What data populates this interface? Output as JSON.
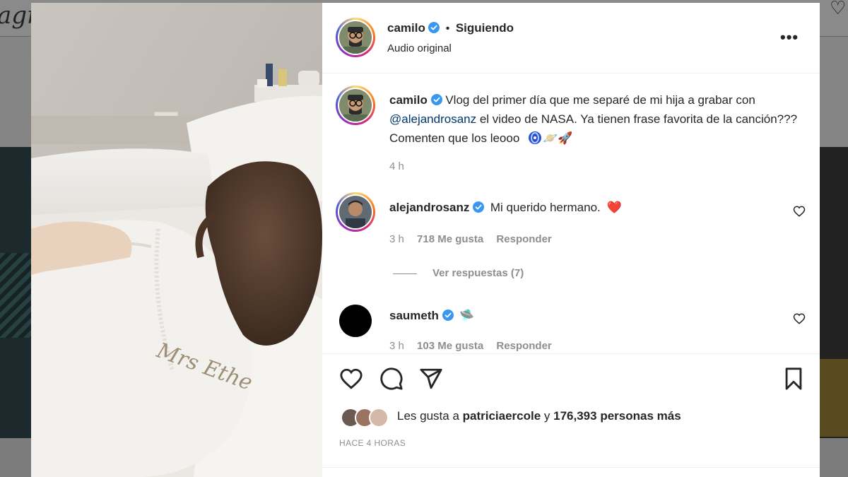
{
  "background": {
    "logo_text": "agr"
  },
  "post": {
    "author": "camilo",
    "follow_status": "Siguiendo",
    "subtitle": "Audio original",
    "more_label": "•••"
  },
  "caption": {
    "username": "camilo",
    "text_before": "Vlog del primer día que me separé de mi hija a grabar con ",
    "mention": "@alejandrosanz",
    "text_after": " el video de NASA. Ya tienen frase favorita de la canción??? Comenten que los leooo",
    "emojis": "🪐🚀",
    "time": "4 h"
  },
  "comments": [
    {
      "username": "alejandrosanz",
      "text": "Mi querido hermano.",
      "emoji": "❤️",
      "time": "3 h",
      "likes": "718 Me gusta",
      "reply": "Responder",
      "view_replies": "Ver respuestas (7)"
    },
    {
      "username": "saumeth",
      "emoji": "🛸",
      "time": "3 h",
      "likes": "103 Me gusta",
      "reply": "Responder"
    }
  ],
  "likes": {
    "prefix": "Les gusta a ",
    "user": "patriciaercole",
    "middle": " y ",
    "count": "176,393 personas más"
  },
  "timestamp": "HACE 4 HORAS",
  "media": {
    "embroidery_text": "Mrs Ethe"
  },
  "colors": {
    "verified": "#3897f0",
    "mention": "#00376b",
    "heart": "#e0132c"
  },
  "icons": [
    "heart-icon",
    "comment-icon",
    "share-icon",
    "bookmark-icon",
    "verified-badge-icon",
    "more-options-icon"
  ]
}
